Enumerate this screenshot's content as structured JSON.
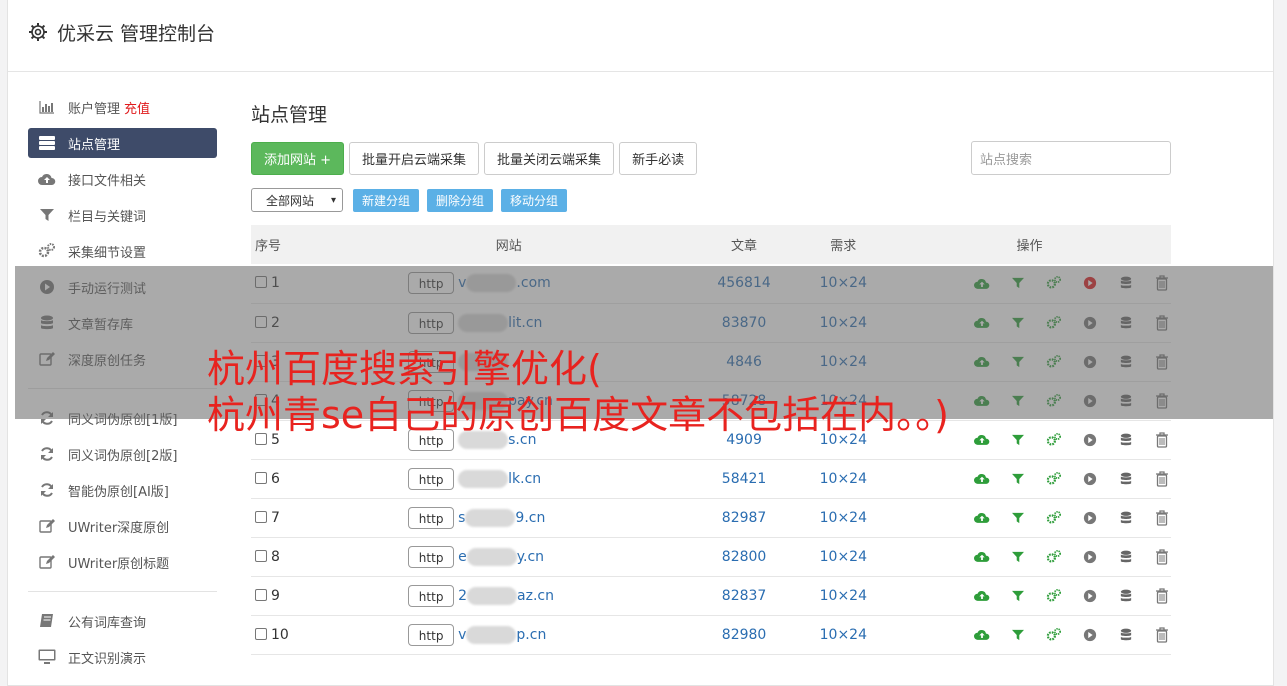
{
  "header": {
    "title": "优采云 管理控制台"
  },
  "sidebar": {
    "groups": [
      [
        {
          "label": "账户管理",
          "extra": "充值",
          "icon": "bar-chart-icon"
        },
        {
          "label": "站点管理",
          "icon": "server-icon",
          "active": true
        },
        {
          "label": "接口文件相关",
          "icon": "cloud-upload-icon"
        },
        {
          "label": "栏目与关键词",
          "icon": "filter-icon"
        },
        {
          "label": "采集细节设置",
          "icon": "gears-icon"
        },
        {
          "label": "手动运行测试",
          "icon": "play-circle-icon"
        },
        {
          "label": "文章暂存库",
          "icon": "database-icon"
        },
        {
          "label": "深度原创任务",
          "icon": "edit-icon"
        }
      ],
      [
        {
          "label": "同义词伪原创[1版]",
          "icon": "refresh-icon"
        },
        {
          "label": "同义词伪原创[2版]",
          "icon": "refresh-icon"
        },
        {
          "label": "智能伪原创[AI版]",
          "icon": "refresh-icon"
        },
        {
          "label": "UWriter深度原创",
          "icon": "edit-icon"
        },
        {
          "label": "UWriter原创标题",
          "icon": "edit-icon"
        }
      ],
      [
        {
          "label": "公有词库查询",
          "icon": "book-icon"
        },
        {
          "label": "正文识别演示",
          "icon": "monitor-icon"
        }
      ]
    ]
  },
  "main": {
    "title": "站点管理",
    "add_label": "添加网站 +",
    "batch_on_label": "批量开启云端采集",
    "batch_off_label": "批量关闭云端采集",
    "guide_label": "新手必读",
    "search_placeholder": "站点搜索",
    "group_select": "全部网站",
    "new_group": "新建分组",
    "del_group": "删除分组",
    "move_group": "移动分组",
    "columns": [
      "序号",
      "网站",
      "文章",
      "需求",
      "操作"
    ],
    "rows": [
      {
        "no": "1",
        "http": "http",
        "pre": "v",
        "suf": ".com",
        "articles": "456814",
        "demand": "10×24",
        "running": true
      },
      {
        "no": "2",
        "http": "http",
        "pre": "",
        "suf": "lit.cn",
        "articles": "83870",
        "demand": "10×24",
        "running": false
      },
      {
        "no": "3",
        "http": "http",
        "pre": "",
        "suf": "",
        "articles": "4846",
        "demand": "10×24",
        "running": false
      },
      {
        "no": "4",
        "http": "http",
        "pre": "",
        "suf": "pay.cn",
        "articles": "58728",
        "demand": "10×24",
        "running": false
      },
      {
        "no": "5",
        "http": "http",
        "pre": "",
        "suf": "s.cn",
        "articles": "4909",
        "demand": "10×24",
        "running": false
      },
      {
        "no": "6",
        "http": "http",
        "pre": "",
        "suf": "lk.cn",
        "articles": "58421",
        "demand": "10×24",
        "running": false
      },
      {
        "no": "7",
        "http": "http",
        "pre": "s",
        "suf": "9.cn",
        "articles": "82987",
        "demand": "10×24",
        "running": false
      },
      {
        "no": "8",
        "http": "http",
        "pre": "e",
        "suf": "y.cn",
        "articles": "82800",
        "demand": "10×24",
        "running": false
      },
      {
        "no": "9",
        "http": "http",
        "pre": "2",
        "suf": "az.cn",
        "articles": "82837",
        "demand": "10×24",
        "running": false
      },
      {
        "no": "10",
        "http": "http",
        "pre": "v",
        "suf": "p.cn",
        "articles": "82980",
        "demand": "10×24",
        "running": false
      }
    ]
  },
  "caption": {
    "line1": "杭州百度搜索引擎优化(",
    "line2": "杭州青se自己的原创百度文章不包括在内。。)"
  },
  "colors": {
    "active_nav": "#3e4b69",
    "green": "#5cb85c",
    "blue_btn": "#5bb0e6",
    "link": "#2a6db1",
    "caption": "#e8231f"
  }
}
